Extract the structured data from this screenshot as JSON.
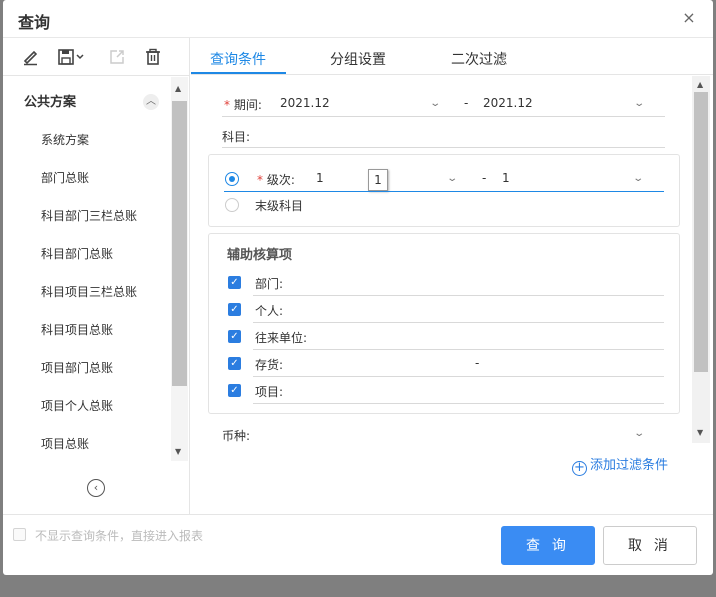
{
  "dialog": {
    "title": "查询",
    "close_glyph": "×"
  },
  "toolbar": {
    "icons": [
      "edit-icon",
      "save-icon",
      "export-icon",
      "delete-icon"
    ]
  },
  "schemes": {
    "group_title": "公共方案",
    "toggle_glyph": "︿",
    "items": [
      "系统方案",
      "部门总账",
      "科目部门三栏总账",
      "科目部门总账",
      "科目项目三栏总账",
      "科目项目总账",
      "项目部门总账",
      "项目个人总账",
      "项目总账"
    ]
  },
  "tabs": [
    "查询条件",
    "分组设置",
    "二次过滤"
  ],
  "form": {
    "period": {
      "required_mark": "*",
      "label": "期间:",
      "from": "2021.12",
      "sep": "-",
      "to": "2021.12"
    },
    "subject": {
      "label": "科目:"
    },
    "level": {
      "required_mark": "*",
      "label": "级次:",
      "from": "1",
      "sep": "-",
      "to": "1",
      "tooltip": "1"
    },
    "leaf_subject": {
      "label": "末级科目"
    },
    "aux": {
      "title": "辅助核算项",
      "items": [
        {
          "label": "部门:",
          "checked": true,
          "value": ""
        },
        {
          "label": "个人:",
          "checked": true,
          "value": ""
        },
        {
          "label": "往来单位:",
          "checked": true,
          "value": ""
        },
        {
          "label": "存货:",
          "checked": true,
          "value": "-"
        },
        {
          "label": "项目:",
          "checked": true,
          "value": ""
        }
      ]
    },
    "currency": {
      "label": "币种:"
    }
  },
  "add_filter": {
    "icon": "plus-circle-icon",
    "label": "添加过滤条件"
  },
  "footer": {
    "skip_label": "不显示查询条件，直接进入报表",
    "query_button": "查 询",
    "cancel_button": "取 消"
  },
  "colors": {
    "accent": "#1e88e5",
    "primary_button": "#3a8cf3",
    "required": "#e0403a"
  }
}
